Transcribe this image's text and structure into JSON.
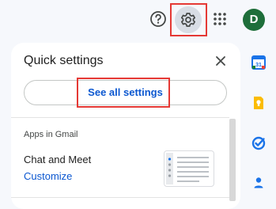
{
  "topbar": {
    "help_icon": "help-circle-icon",
    "settings_icon": "gear-icon",
    "apps_icon": "apps-grid-icon",
    "avatar_initial": "D",
    "avatar_color": "#1e6e3a"
  },
  "quick_settings": {
    "title": "Quick settings",
    "see_all_label": "See all settings",
    "section_heading": "Apps in Gmail",
    "chat_meet_label": "Chat and Meet",
    "customize_label": "Customize"
  },
  "side_rail": [
    {
      "icon": "calendar-icon",
      "color": "#1a73e8"
    },
    {
      "icon": "keep-icon",
      "color": "#fbbc04"
    },
    {
      "icon": "tasks-icon",
      "color": "#1a73e8"
    },
    {
      "icon": "contacts-icon",
      "color": "#1a73e8"
    }
  ],
  "colors": {
    "link": "#0b57d0",
    "highlight": "#e53935",
    "background": "#f6f8fc"
  }
}
